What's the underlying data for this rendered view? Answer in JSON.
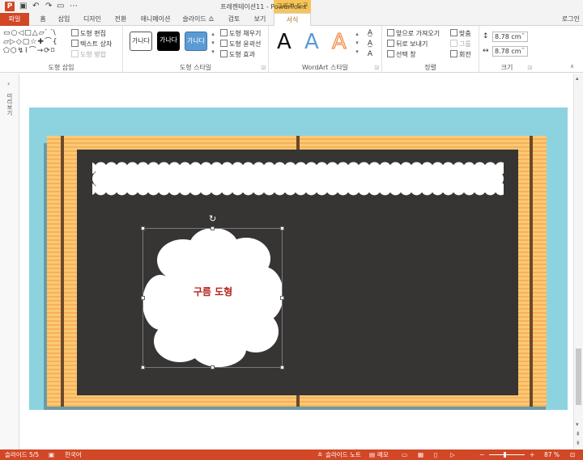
{
  "titlebar": {
    "app_icon": "P",
    "title": "프레젠테이션11 - PowerPoint",
    "context_tab": "그리기 도구",
    "qat": [
      "save-icon",
      "undo-icon",
      "redo-icon",
      "start-from-beginning-icon",
      "more-icon"
    ]
  },
  "tabs": {
    "file": "파일",
    "items": [
      "홈",
      "삽입",
      "디자인",
      "전환",
      "애니메이션",
      "슬라이드 쇼",
      "검토",
      "보기"
    ],
    "format": "서식",
    "login": "로그인"
  },
  "ribbon": {
    "insert_shapes": {
      "label": "도형 삽입",
      "shape_glyphs": "▭○◁□△▱⌒\\\n▱▷◇▢☆✚⌒{\n⬠⬡↯⌇⌒→⟳⌑",
      "edit_shape": "도형 편집",
      "text_box": "텍스트 상자",
      "merge_shapes": "도형 병합"
    },
    "shape_styles": {
      "label": "도형 스타일",
      "presets": [
        "가나다",
        "가나다",
        "가나다"
      ],
      "fill": "도형 채우기",
      "outline": "도형 윤곽선",
      "effects": "도형 효과"
    },
    "wordart": {
      "label": "WordArt 스타일",
      "samples": [
        "A",
        "A",
        "A"
      ]
    },
    "arrange": {
      "label": "정렬",
      "bring_forward": "앞으로 가져오기",
      "send_backward": "뒤로 보내기",
      "selection_pane": "선택 창",
      "align": "맞춤",
      "group": "그룹",
      "rotate": "회전"
    },
    "size": {
      "label": "크기",
      "height": "8.78 cm",
      "width": "8.78 cm"
    }
  },
  "left_pane": {
    "toggle": "›",
    "label": "미리보기"
  },
  "slide": {
    "cloud_text": "구름 도형"
  },
  "statusbar": {
    "slide_info": "슬라이드 5/5",
    "language": "한국어",
    "notes": "슬라이드 노트",
    "comments": "메모",
    "zoom_minus": "−",
    "zoom_plus": "+",
    "zoom": "87 %"
  },
  "colors": {
    "accent": "#d24726",
    "context_tab": "#f6c55a",
    "slide_bg": "#8dd3df",
    "board": "#fbc876",
    "chalkboard": "#373434",
    "cloud_text": "#b3261e"
  }
}
